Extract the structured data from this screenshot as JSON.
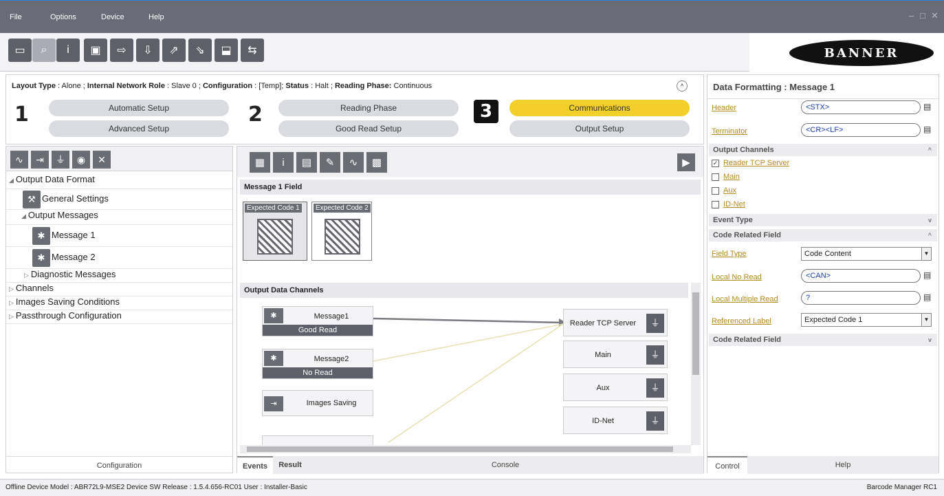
{
  "menu": [
    "File",
    "Options",
    "Device",
    "Help"
  ],
  "window_controls": {
    "min": "–",
    "max": "□",
    "close": "✕"
  },
  "brand": "BANNER",
  "layout_info": {
    "layout_type_label": "Layout Type",
    "layout_type_value": "Alone",
    "network_role_label": "Internal Network Role",
    "network_role_value": "Slave 0",
    "configuration_label": "Configuration",
    "configuration_value": "[Temp]",
    "status_label": "Status",
    "status_value": "Halt",
    "reading_phase_label": "Reading Phase:",
    "reading_phase_value": "Continuous"
  },
  "steps": [
    {
      "num": "1",
      "top": "Automatic Setup",
      "bottom": "Advanced Setup"
    },
    {
      "num": "2",
      "top": "Reading Phase",
      "bottom": "Good Read Setup"
    },
    {
      "num": "3",
      "top": "Communications",
      "bottom": "Output Setup"
    }
  ],
  "tree": {
    "output_data_format": "Output Data Format",
    "general_settings": "General Settings",
    "output_messages": "Output Messages",
    "message1": "Message 1",
    "message2": "Message 2",
    "diagnostic_messages": "Diagnostic Messages",
    "channels": "Channels",
    "images_saving": "Images Saving Conditions",
    "passthrough": "Passthrough Configuration",
    "footer": "Configuration"
  },
  "center": {
    "message_field_title": "Message 1 Field",
    "expected_code_1": "Expected Code 1",
    "expected_code_2": "Expected Code 2",
    "output_channels_title": "Output Data Channels",
    "nodes": [
      {
        "label": "Message1",
        "sub": "Good Read"
      },
      {
        "label": "Message2",
        "sub": "No Read"
      },
      {
        "label": "Images Saving",
        "sub": ""
      }
    ],
    "channels": [
      "Reader TCP Server",
      "Main",
      "Aux",
      "ID-Net"
    ],
    "tabs": [
      "Events",
      "Result",
      "Console"
    ]
  },
  "right": {
    "title_label": "Data Formatting :",
    "title_value": "Message 1",
    "header_label": "Header",
    "header_value": "<STX>",
    "terminator_label": "Terminator",
    "terminator_value": "<CR><LF>",
    "output_channels_title": "Output Channels",
    "channels": [
      {
        "label": "Reader TCP Server",
        "checked": "✓"
      },
      {
        "label": "Main",
        "checked": ""
      },
      {
        "label": "Aux",
        "checked": ""
      },
      {
        "label": "ID-Net",
        "checked": ""
      }
    ],
    "event_type_title": "Event Type",
    "code_related_title": "Code Related Field",
    "field_type_label": "Field Type",
    "field_type_value": "Code Content",
    "local_no_read_label": "Local No Read",
    "local_no_read_value": "<CAN>",
    "local_multiple_read_label": "Local Multiple Read",
    "local_multiple_read_value": "?",
    "referenced_label_label": "Referenced Label",
    "referenced_label_value": "Expected Code  1",
    "code_related_title_2": "Code Related Field",
    "tabs": [
      "Control",
      "Help"
    ]
  },
  "status_bar": {
    "left": "Offline Device Model : ABR72L9-MSE2   Device SW Release : 1.5.4.656-RC01   User : Installer-Basic",
    "right": "Barcode Manager RC1"
  },
  "colors": {
    "accent": "#f2cf2a",
    "dark_icon": "#6a6c74",
    "titlebar": "#6b6b78",
    "link": "#b58a1e"
  }
}
